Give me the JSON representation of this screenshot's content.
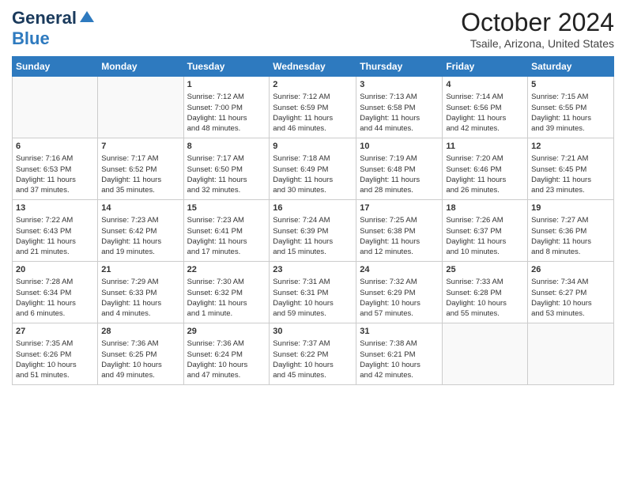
{
  "header": {
    "logo_line1": "General",
    "logo_line2": "Blue",
    "month_title": "October 2024",
    "subtitle": "Tsaile, Arizona, United States"
  },
  "days_of_week": [
    "Sunday",
    "Monday",
    "Tuesday",
    "Wednesday",
    "Thursday",
    "Friday",
    "Saturday"
  ],
  "weeks": [
    [
      {
        "num": "",
        "detail": ""
      },
      {
        "num": "",
        "detail": ""
      },
      {
        "num": "1",
        "detail": "Sunrise: 7:12 AM\nSunset: 7:00 PM\nDaylight: 11 hours\nand 48 minutes."
      },
      {
        "num": "2",
        "detail": "Sunrise: 7:12 AM\nSunset: 6:59 PM\nDaylight: 11 hours\nand 46 minutes."
      },
      {
        "num": "3",
        "detail": "Sunrise: 7:13 AM\nSunset: 6:58 PM\nDaylight: 11 hours\nand 44 minutes."
      },
      {
        "num": "4",
        "detail": "Sunrise: 7:14 AM\nSunset: 6:56 PM\nDaylight: 11 hours\nand 42 minutes."
      },
      {
        "num": "5",
        "detail": "Sunrise: 7:15 AM\nSunset: 6:55 PM\nDaylight: 11 hours\nand 39 minutes."
      }
    ],
    [
      {
        "num": "6",
        "detail": "Sunrise: 7:16 AM\nSunset: 6:53 PM\nDaylight: 11 hours\nand 37 minutes."
      },
      {
        "num": "7",
        "detail": "Sunrise: 7:17 AM\nSunset: 6:52 PM\nDaylight: 11 hours\nand 35 minutes."
      },
      {
        "num": "8",
        "detail": "Sunrise: 7:17 AM\nSunset: 6:50 PM\nDaylight: 11 hours\nand 32 minutes."
      },
      {
        "num": "9",
        "detail": "Sunrise: 7:18 AM\nSunset: 6:49 PM\nDaylight: 11 hours\nand 30 minutes."
      },
      {
        "num": "10",
        "detail": "Sunrise: 7:19 AM\nSunset: 6:48 PM\nDaylight: 11 hours\nand 28 minutes."
      },
      {
        "num": "11",
        "detail": "Sunrise: 7:20 AM\nSunset: 6:46 PM\nDaylight: 11 hours\nand 26 minutes."
      },
      {
        "num": "12",
        "detail": "Sunrise: 7:21 AM\nSunset: 6:45 PM\nDaylight: 11 hours\nand 23 minutes."
      }
    ],
    [
      {
        "num": "13",
        "detail": "Sunrise: 7:22 AM\nSunset: 6:43 PM\nDaylight: 11 hours\nand 21 minutes."
      },
      {
        "num": "14",
        "detail": "Sunrise: 7:23 AM\nSunset: 6:42 PM\nDaylight: 11 hours\nand 19 minutes."
      },
      {
        "num": "15",
        "detail": "Sunrise: 7:23 AM\nSunset: 6:41 PM\nDaylight: 11 hours\nand 17 minutes."
      },
      {
        "num": "16",
        "detail": "Sunrise: 7:24 AM\nSunset: 6:39 PM\nDaylight: 11 hours\nand 15 minutes."
      },
      {
        "num": "17",
        "detail": "Sunrise: 7:25 AM\nSunset: 6:38 PM\nDaylight: 11 hours\nand 12 minutes."
      },
      {
        "num": "18",
        "detail": "Sunrise: 7:26 AM\nSunset: 6:37 PM\nDaylight: 11 hours\nand 10 minutes."
      },
      {
        "num": "19",
        "detail": "Sunrise: 7:27 AM\nSunset: 6:36 PM\nDaylight: 11 hours\nand 8 minutes."
      }
    ],
    [
      {
        "num": "20",
        "detail": "Sunrise: 7:28 AM\nSunset: 6:34 PM\nDaylight: 11 hours\nand 6 minutes."
      },
      {
        "num": "21",
        "detail": "Sunrise: 7:29 AM\nSunset: 6:33 PM\nDaylight: 11 hours\nand 4 minutes."
      },
      {
        "num": "22",
        "detail": "Sunrise: 7:30 AM\nSunset: 6:32 PM\nDaylight: 11 hours\nand 1 minute."
      },
      {
        "num": "23",
        "detail": "Sunrise: 7:31 AM\nSunset: 6:31 PM\nDaylight: 10 hours\nand 59 minutes."
      },
      {
        "num": "24",
        "detail": "Sunrise: 7:32 AM\nSunset: 6:29 PM\nDaylight: 10 hours\nand 57 minutes."
      },
      {
        "num": "25",
        "detail": "Sunrise: 7:33 AM\nSunset: 6:28 PM\nDaylight: 10 hours\nand 55 minutes."
      },
      {
        "num": "26",
        "detail": "Sunrise: 7:34 AM\nSunset: 6:27 PM\nDaylight: 10 hours\nand 53 minutes."
      }
    ],
    [
      {
        "num": "27",
        "detail": "Sunrise: 7:35 AM\nSunset: 6:26 PM\nDaylight: 10 hours\nand 51 minutes."
      },
      {
        "num": "28",
        "detail": "Sunrise: 7:36 AM\nSunset: 6:25 PM\nDaylight: 10 hours\nand 49 minutes."
      },
      {
        "num": "29",
        "detail": "Sunrise: 7:36 AM\nSunset: 6:24 PM\nDaylight: 10 hours\nand 47 minutes."
      },
      {
        "num": "30",
        "detail": "Sunrise: 7:37 AM\nSunset: 6:22 PM\nDaylight: 10 hours\nand 45 minutes."
      },
      {
        "num": "31",
        "detail": "Sunrise: 7:38 AM\nSunset: 6:21 PM\nDaylight: 10 hours\nand 42 minutes."
      },
      {
        "num": "",
        "detail": ""
      },
      {
        "num": "",
        "detail": ""
      }
    ]
  ]
}
